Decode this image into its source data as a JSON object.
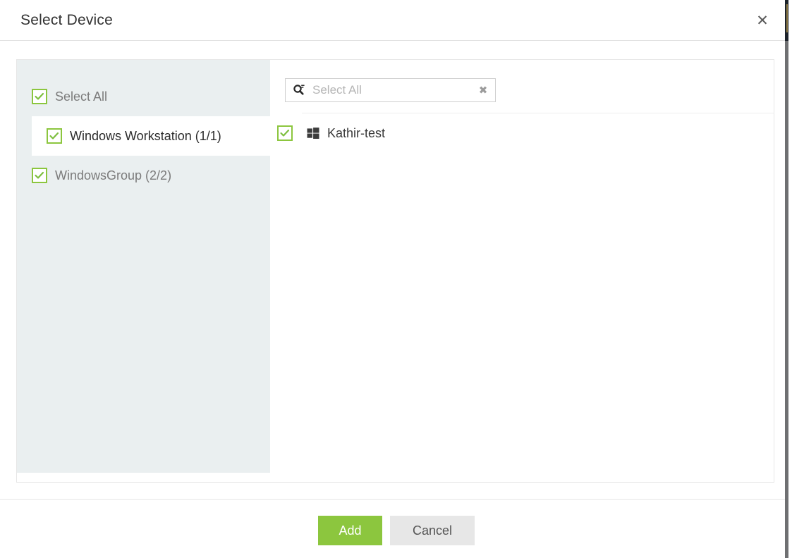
{
  "dialog": {
    "title": "Select Device",
    "close_icon": "close-icon",
    "close_label": "✕"
  },
  "groups": {
    "items": [
      {
        "label": "Select All",
        "checked": true,
        "selected": false
      },
      {
        "label": "Windows Workstation (1/1)",
        "checked": true,
        "selected": true
      },
      {
        "label": "WindowsGroup (2/2)",
        "checked": true,
        "selected": false
      }
    ]
  },
  "search": {
    "value": "",
    "placeholder": "Select All",
    "icon": "search-icon",
    "clear_icon": "clear-icon",
    "clear_label": "✖"
  },
  "devices": {
    "items": [
      {
        "label": "Kathir-test",
        "checked": true,
        "os_icon": "windows-logo-icon"
      }
    ]
  },
  "footer": {
    "add_label": "Add",
    "cancel_label": "Cancel"
  },
  "colors": {
    "accent_green": "#8cc63e",
    "panel_bg": "#eaeff0",
    "secondary_btn": "#e7e7e7",
    "title_text": "#333333"
  }
}
